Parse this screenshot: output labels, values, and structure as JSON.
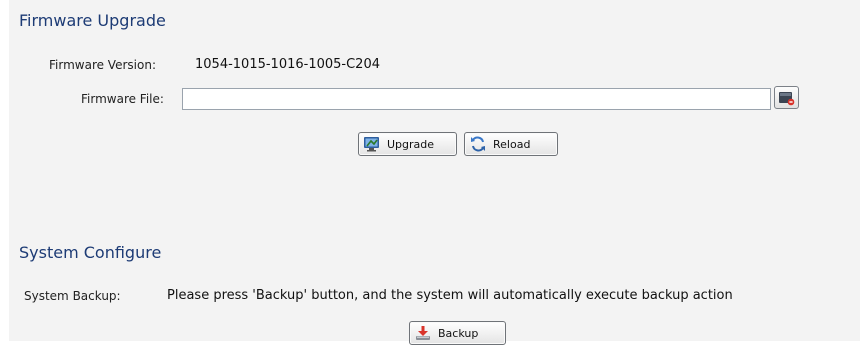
{
  "firmware": {
    "title": "Firmware Upgrade",
    "version_label": "Firmware Version:",
    "version_value": "1054-1015-1016-1005-C204",
    "file_label": "Firmware File:",
    "file_value": "",
    "upgrade_label": "Upgrade",
    "reload_label": "Reload"
  },
  "system": {
    "title": "System Configure",
    "backup_label": "System Backup:",
    "backup_message": "Please press 'Backup' button, and the system will automatically execute backup action",
    "backup_button": "Backup"
  },
  "icons": {
    "browse": "folder-browse-icon",
    "upgrade": "monitor-upgrade-icon",
    "reload": "reload-arrows-icon",
    "backup": "backup-tray-icon"
  },
  "colors": {
    "title": "#1d3b75",
    "panel_bg": "#f3f3f3"
  }
}
